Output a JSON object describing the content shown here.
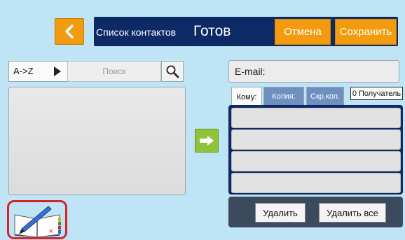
{
  "header": {
    "title": "Список контактов",
    "status": "Готов",
    "cancel_label": "Отмена",
    "save_label": "Сохранить"
  },
  "left": {
    "sort_label": "A->Z",
    "search_placeholder": "Поиск"
  },
  "right": {
    "email_label": "E-mail:",
    "tabs": [
      {
        "label": "Кому:"
      },
      {
        "label": "Копия:"
      },
      {
        "label": "Скр.коп."
      }
    ],
    "recipient_count": "0 Получатель",
    "delete_label": "Удалить",
    "delete_all_label": "Удалить все"
  },
  "colors": {
    "background": "#bfe4f6",
    "header": "#0e2a66",
    "accent_orange": "#f29b0f",
    "arrow_green": "#8fc43a",
    "highlight_red": "#d9232b"
  }
}
